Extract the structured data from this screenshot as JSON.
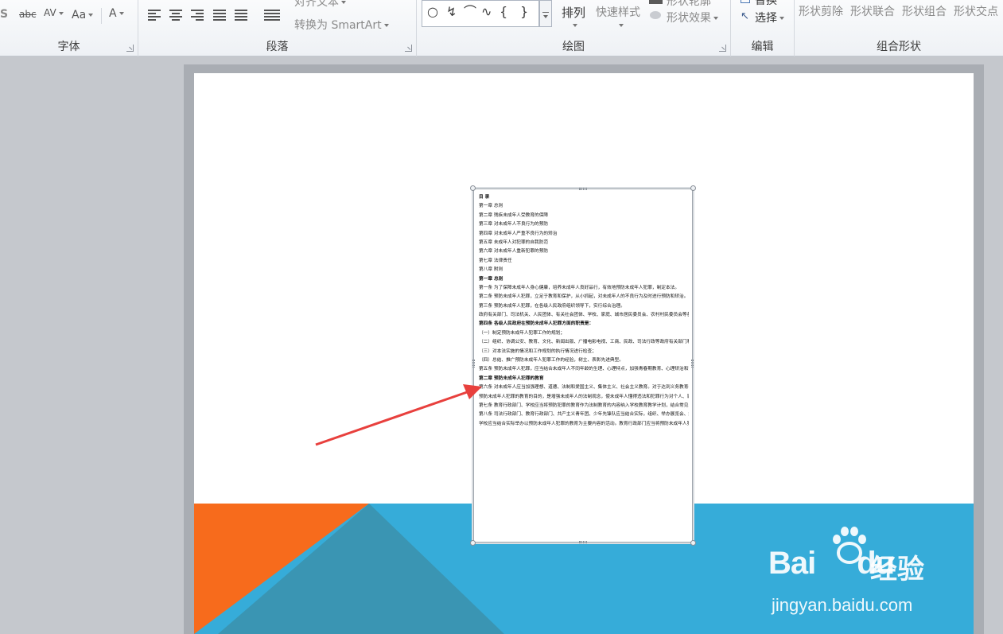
{
  "ribbon": {
    "font_group": {
      "label": "字体",
      "strike_sample": "abc",
      "spacing_sample": "AV",
      "case_sample": "Aa",
      "color_sample": "A",
      "edge_glyph": "S"
    },
    "paragraph_group": {
      "label": "段落",
      "align_text_label": "对齐文本",
      "convert_smartart_label": "转换为 SmartArt"
    },
    "drawing_group": {
      "label": "绘图",
      "arrange_label": "排列",
      "quick_styles_label": "快速样式",
      "shape_outline_label": "形状轮廓",
      "shape_effects_label": "形状效果"
    },
    "editing_group": {
      "label": "编辑",
      "replace_label": "替换",
      "select_label": "选择"
    },
    "combine_group": {
      "label": "组合形状",
      "items": [
        "形状剪除",
        "形状联合",
        "形状组合",
        "形状交点"
      ]
    }
  },
  "textbox": {
    "lines": [
      "目 录",
      "第一章  总则",
      "第二章  残疾未成年人受教育的保障",
      "第三章  对未成年人不良行为的预防",
      "第四章  对未成年人严重不良行为的矫治",
      "第五章  未成年人对犯罪的自我防范",
      "第六章  对未成年人重新犯罪的预防",
      "第七章  法律责任",
      "第八章  附则",
      "第一章  总则",
      "第一条 为了保障未成年人身心健康，培养未成年人良好品行，有效地预防未成年人犯罪，制定本法。",
      "第二条 预防未成年人犯罪，立足于教育和保护，从小抓起，对未成年人的不良行为及时进行预防和矫治。",
      "第三条 预防未成年人犯罪，在各级人民政府组织领导下，实行综合治理。",
      "政府有关部门、司法机关、人民团体、有关社会团体、学校、家庭、城市居民委员会、农村村民委员会等各方面共同参与，各负其责，做好预防未成年人犯罪工作，为未成年人身心健康发展创造良好的社会环境。",
      "第四条 各级人民政府在预防未成年人犯罪方面的职责是：",
      "（一）制定预防未成年人犯罪工作的规划；",
      "（二）组织、协调公安、教育、文化、新闻出版、广播电影电视、工商、民政、司法行政等政府有关部门和其他社会组织进行预防未成年人犯罪工作；",
      "（三）对本法实施的情况和工作规划的执行情况进行检查；",
      "（四）总结、推广预防未成年人犯罪工作的经验，树立、表彰先进典型。",
      "第五条 预防未成年人犯罪，应当结合未成年人不同年龄的生理、心理特点，加强青春期教育、心理矫治和预防犯罪对策的研究。",
      "第二章  预防未成年人犯罪的教育",
      "第六条 对未成年人应当加强理想、道德、法制和爱国主义、集体主义、社会主义教育。对于达到义务教育年龄的未成年人，在进行上述教育的同时，应当进行预防犯罪的教育。",
      "预防未成年人犯罪的教育的目的，是增强未成年人的法制观念，使未成年人懂得违法和犯罪行为对个人、家庭、社会造成的危害，违法和犯罪行为应当承担的法律责任，树立遵纪守法和防范违法犯罪的意识。",
      "第七条 教育行政部门、学校应当将预防犯罪的教育作为法制教育的内容纳入学校教育教学计划，结合常见多发的未成年人犯罪，对不同年龄的未成年人进行有针对性的预防犯罪教育。",
      "第八条 司法行政部门、教育行政部门、共产主义青年团、少年先锋队应当结合实际，组织、举办展览会、报告会、演讲会等多种形式的预防未成年人犯罪的法制宣传活动。",
      "学校应当结合实际举办以预防未成年人犯罪的教育为主要内容的活动。教育行政部门应当将预防未成年人犯罪教育的工作效果作为考核学校工作的一项重要内容。"
    ],
    "bold_indices": [
      0,
      9,
      14,
      20
    ]
  },
  "watermark": {
    "logo_text": "Bai",
    "logo_text2": "du",
    "cn_text": "经验",
    "url": "jingyan.baidu.com"
  },
  "colors": {
    "orange": "#f76b1c",
    "teal_dark": "#3a95b3",
    "blue": "#36acd9",
    "arrow": "#e8403d"
  }
}
